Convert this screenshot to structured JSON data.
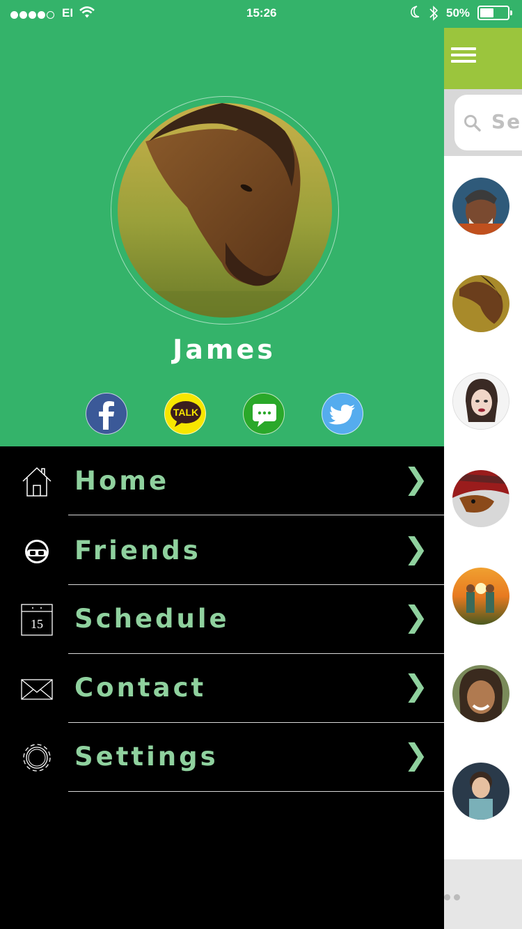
{
  "status_bar": {
    "carrier": "EI",
    "time": "15:26",
    "battery_percent": "50%",
    "battery_level": 0.5,
    "signal_bars_filled": 4,
    "signal_bars_total": 5
  },
  "drawer": {
    "user_name": "James",
    "social": [
      {
        "name": "facebook",
        "icon": "facebook-icon",
        "color": "#3b5998"
      },
      {
        "name": "kakaotalk",
        "icon": "kakaotalk-icon",
        "label": "TALK",
        "color": "#f7e600"
      },
      {
        "name": "message",
        "icon": "message-icon",
        "color": "#2aa82a"
      },
      {
        "name": "twitter",
        "icon": "twitter-icon",
        "color": "#55acee"
      }
    ],
    "menu": [
      {
        "label": "Home",
        "icon": "home-icon"
      },
      {
        "label": "Friends",
        "icon": "friends-icon"
      },
      {
        "label": "Schedule",
        "icon": "calendar-icon",
        "icon_text": "15"
      },
      {
        "label": "Contact",
        "icon": "envelope-icon"
      },
      {
        "label": "Settings",
        "icon": "gear-icon"
      }
    ],
    "chevron": "❯"
  },
  "right_panel": {
    "search_placeholder": "Sea",
    "contacts": [
      "avatar-old-man",
      "avatar-horse",
      "avatar-woman",
      "avatar-dog",
      "avatar-children",
      "avatar-girl",
      "avatar-boy"
    ]
  },
  "colors": {
    "header_green": "#34b36a",
    "menu_text": "#8fd19e",
    "accent_lime": "#9bc53d"
  }
}
